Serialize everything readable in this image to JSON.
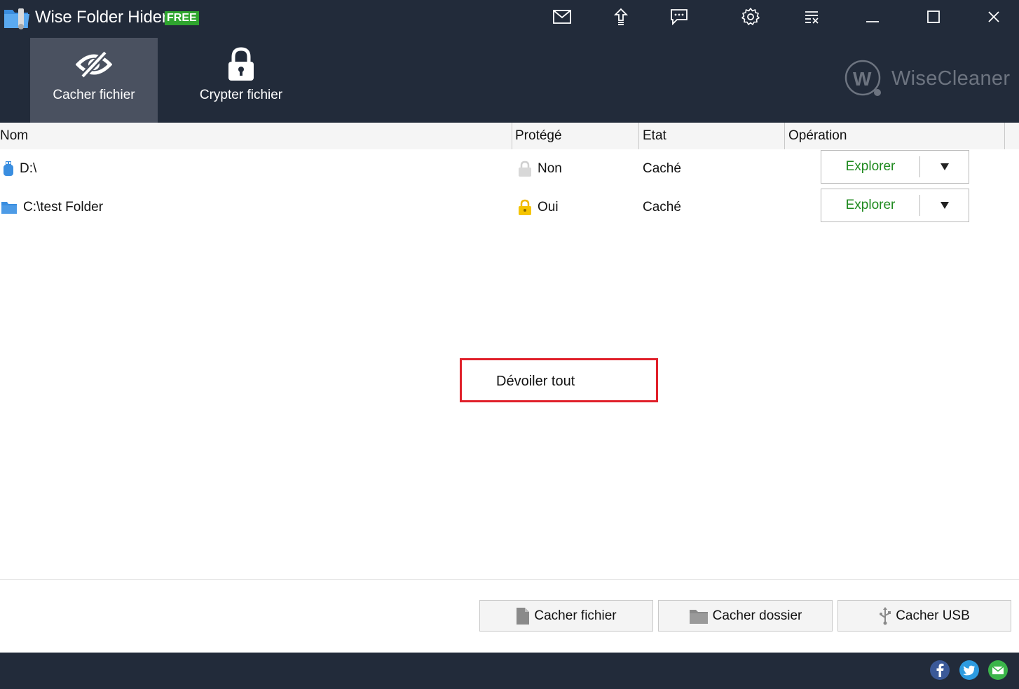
{
  "app": {
    "title": "Wise Folder Hider",
    "badge": "FREE"
  },
  "toolbar": {
    "icons": [
      "mail-icon",
      "upgrade-icon",
      "feedback-icon",
      "settings-icon",
      "menu-icon",
      "minimize-icon",
      "maximize-icon",
      "close-icon"
    ]
  },
  "nav": {
    "tabs": [
      {
        "label": "Cacher fichier",
        "icon": "eye-slash-icon",
        "active": true
      },
      {
        "label": "Crypter fichier",
        "icon": "lock-icon",
        "active": false
      }
    ]
  },
  "brand": {
    "name": "WiseCleaner",
    "logo_letter": "W"
  },
  "table": {
    "columns": [
      "Nom",
      "Protégé",
      "Etat",
      "Opération"
    ],
    "rows": [
      {
        "name": "D:\\",
        "type_icon": "usb-drive-icon",
        "protected": "Non",
        "protected_icon": "lock-open-gray-icon",
        "state": "Caché",
        "action": "Explorer"
      },
      {
        "name": "C:\\test Folder",
        "type_icon": "folder-icon",
        "protected": "Oui",
        "protected_icon": "lock-yellow-icon",
        "state": "Caché",
        "action": "Explorer"
      }
    ]
  },
  "center_action": {
    "label": "Dévoiler tout"
  },
  "actions": [
    {
      "label": "Cacher fichier",
      "icon": "file-icon"
    },
    {
      "label": "Cacher dossier",
      "icon": "folder-icon"
    },
    {
      "label": "Cacher USB",
      "icon": "usb-icon"
    }
  ],
  "footer": {
    "social": [
      "facebook-icon",
      "twitter-icon",
      "email-icon"
    ]
  },
  "colors": {
    "header_bg": "#222b3a",
    "active_tab": "#4a5160",
    "free_badge": "#2fa52f",
    "explore_text": "#1f8a1f",
    "highlight_border": "#e0202a"
  }
}
